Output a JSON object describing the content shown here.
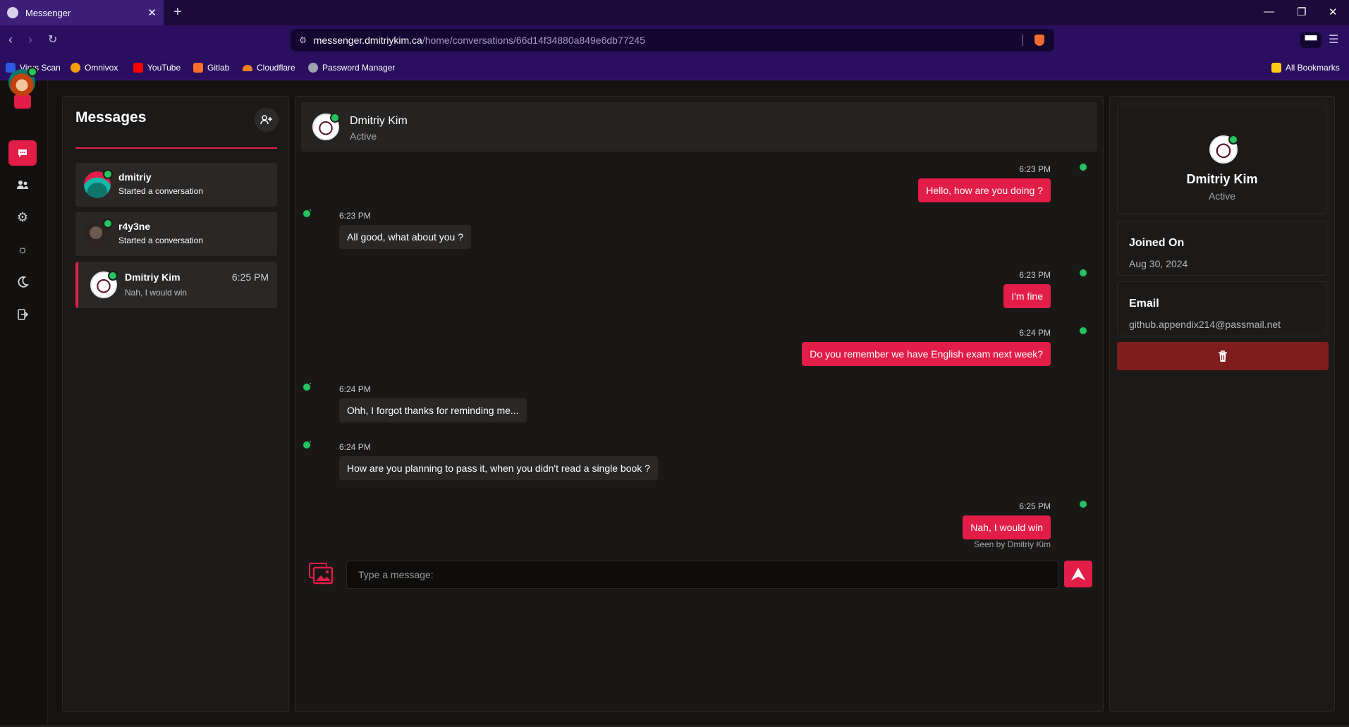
{
  "browser": {
    "tab_title": "Messenger",
    "url_host": "messenger.dmitriykim.ca",
    "url_path": "/home/conversations/66d14f34880a849e6db77245",
    "bookmarks": [
      "Virus Scan",
      "Omnivox",
      "YouTube",
      "Gitlab",
      "Cloudflare",
      "Password Manager"
    ],
    "all_bookmarks": "All Bookmarks"
  },
  "messages_panel": {
    "title": "Messages",
    "conversations": [
      {
        "name": "dmitriy",
        "sub": "Started a conversation",
        "time": ""
      },
      {
        "name": "r4y3ne",
        "sub": "Started a conversation",
        "time": ""
      },
      {
        "name": "Dmitriy Kim",
        "sub": "Nah, I would win",
        "time": "6:25 PM"
      }
    ]
  },
  "chat": {
    "contact_name": "Dmitriy Kim",
    "contact_status": "Active",
    "messages": [
      {
        "time": "6:23 PM",
        "text": "Hello, how are you doing ?",
        "dir": "out"
      },
      {
        "time": "6:23 PM",
        "text": "All good, what about you ?",
        "dir": "in"
      },
      {
        "time": "6:23 PM",
        "text": "I'm fine",
        "dir": "out"
      },
      {
        "time": "6:24 PM",
        "text": "Do you remember we have English exam next week?",
        "dir": "out"
      },
      {
        "time": "6:24 PM",
        "text": "Ohh, I forgot thanks for reminding me...",
        "dir": "in"
      },
      {
        "time": "6:24 PM",
        "text": "How are you planning to pass it, when you didn't read a single book ?",
        "dir": "in"
      },
      {
        "time": "6:25 PM",
        "text": "Nah, I would win",
        "dir": "out"
      }
    ],
    "seen_text": "Seen by Dmitriy Kim",
    "input_placeholder": "Type a message:"
  },
  "profile": {
    "name": "Dmitriy Kim",
    "status": "Active",
    "joined_label": "Joined On",
    "joined_value": "Aug 30, 2024",
    "email_label": "Email",
    "email_value": "github.appendix214@passmail.net"
  },
  "colors": {
    "accent": "#e11d48",
    "online": "#22c55e",
    "danger": "#7f1d1d"
  }
}
